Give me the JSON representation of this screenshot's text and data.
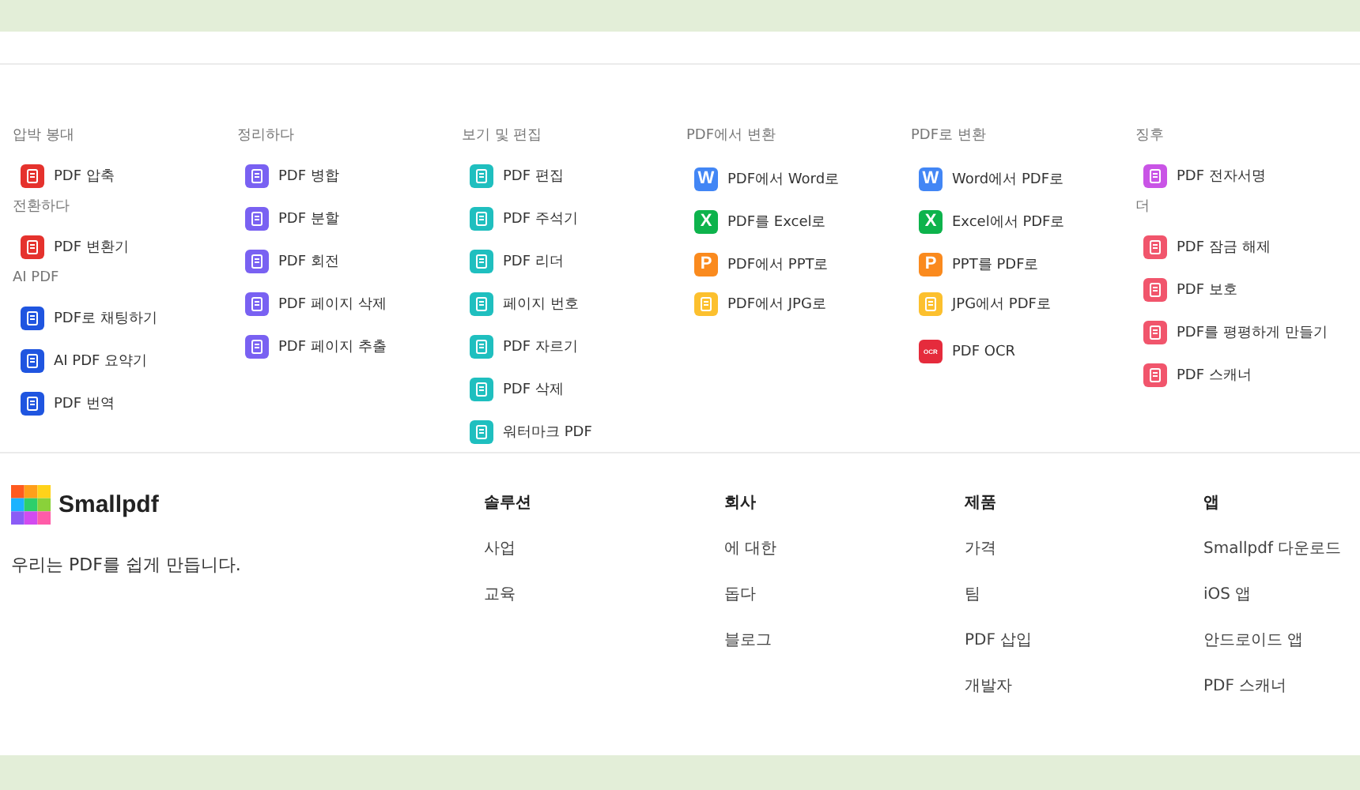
{
  "tool_columns": [
    {
      "sections": [
        {
          "heading": "압박 봉대",
          "tools": [
            {
              "label": "PDF 압축",
              "color": "#e5322d"
            }
          ]
        },
        {
          "heading": "전환하다",
          "tools": [
            {
              "label": "PDF 변환기",
              "color": "#e5322d"
            }
          ]
        },
        {
          "heading": "AI PDF",
          "tools": [
            {
              "label": "PDF로 채팅하기",
              "color": "#1f55e0"
            },
            {
              "label": "AI PDF 요약기",
              "color": "#1f55e0"
            },
            {
              "label": "PDF 번역",
              "color": "#1f55e0"
            }
          ]
        }
      ]
    },
    {
      "sections": [
        {
          "heading": "정리하다",
          "tools": [
            {
              "label": "PDF 병합",
              "color": "#7961f2"
            },
            {
              "label": "PDF 분할",
              "color": "#7961f2"
            },
            {
              "label": "PDF 회전",
              "color": "#7961f2"
            },
            {
              "label": "PDF 페이지 삭제",
              "color": "#7961f2"
            },
            {
              "label": "PDF 페이지 추출",
              "color": "#7961f2"
            }
          ]
        }
      ]
    },
    {
      "sections": [
        {
          "heading": "보기 및 편집",
          "tools": [
            {
              "label": "PDF 편집",
              "color": "#1fbfbf"
            },
            {
              "label": "PDF 주석기",
              "color": "#1fbfbf"
            },
            {
              "label": "PDF 리더",
              "color": "#1fbfbf"
            },
            {
              "label": "페이지 번호",
              "color": "#1fbfbf"
            },
            {
              "label": "PDF 자르기",
              "color": "#1fbfbf"
            },
            {
              "label": "PDF 삭제",
              "color": "#1fbfbf"
            },
            {
              "label": "워터마크 PDF",
              "color": "#1fbfbf"
            }
          ]
        }
      ]
    },
    {
      "sections": [
        {
          "heading": "PDF에서 변환",
          "tools": [
            {
              "label": "PDF에서 Word로",
              "color": "#4286f5",
              "badge": "W"
            },
            {
              "label": "PDF를 Excel로",
              "color": "#0db34c",
              "badge": "X"
            },
            {
              "label": "PDF에서 PPT로",
              "color": "#fa8a1e",
              "badge": "P"
            },
            {
              "label": "PDF에서 JPG로",
              "color": "#fcc02e"
            }
          ]
        }
      ]
    },
    {
      "sections": [
        {
          "heading": "PDF로 변환",
          "tools": [
            {
              "label": "Word에서 PDF로",
              "color": "#4286f5",
              "badge": "W"
            },
            {
              "label": "Excel에서 PDF로",
              "color": "#0db34c",
              "badge": "X"
            },
            {
              "label": "PPT를 PDF로",
              "color": "#fa8a1e",
              "badge": "P"
            },
            {
              "label": "JPG에서 PDF로",
              "color": "#fcc02e"
            },
            {
              "label": "PDF OCR",
              "color": "#e52b3c",
              "badge": "OCR"
            }
          ]
        }
      ]
    },
    {
      "sections": [
        {
          "heading": "징후",
          "tools": [
            {
              "label": "PDF 전자서명",
              "color": "#c954e6"
            }
          ]
        },
        {
          "heading": "더",
          "tools": [
            {
              "label": "PDF 잠금 해제",
              "color": "#f1556c"
            },
            {
              "label": "PDF 보호",
              "color": "#f1556c"
            },
            {
              "label": "PDF를 평평하게 만들기",
              "color": "#f1556c"
            },
            {
              "label": "PDF 스캐너",
              "color": "#f1556c"
            }
          ]
        }
      ]
    }
  ],
  "footer": {
    "brand": {
      "name": "Smallpdf",
      "tagline": "우리는 PDF를 쉽게 만듭니다."
    },
    "link_columns": [
      {
        "heading": "솔루션",
        "links": [
          "사업",
          "교육"
        ]
      },
      {
        "heading": "회사",
        "links": [
          "에 대한",
          "돕다",
          "블로그"
        ]
      },
      {
        "heading": "제품",
        "links": [
          "가격",
          "팀",
          "PDF 삽입",
          "개발자"
        ]
      },
      {
        "heading": "앱",
        "links": [
          "Smallpdf 다운로드",
          "iOS 앱",
          "안드로이드 앱",
          "PDF 스캐너"
        ]
      }
    ]
  }
}
